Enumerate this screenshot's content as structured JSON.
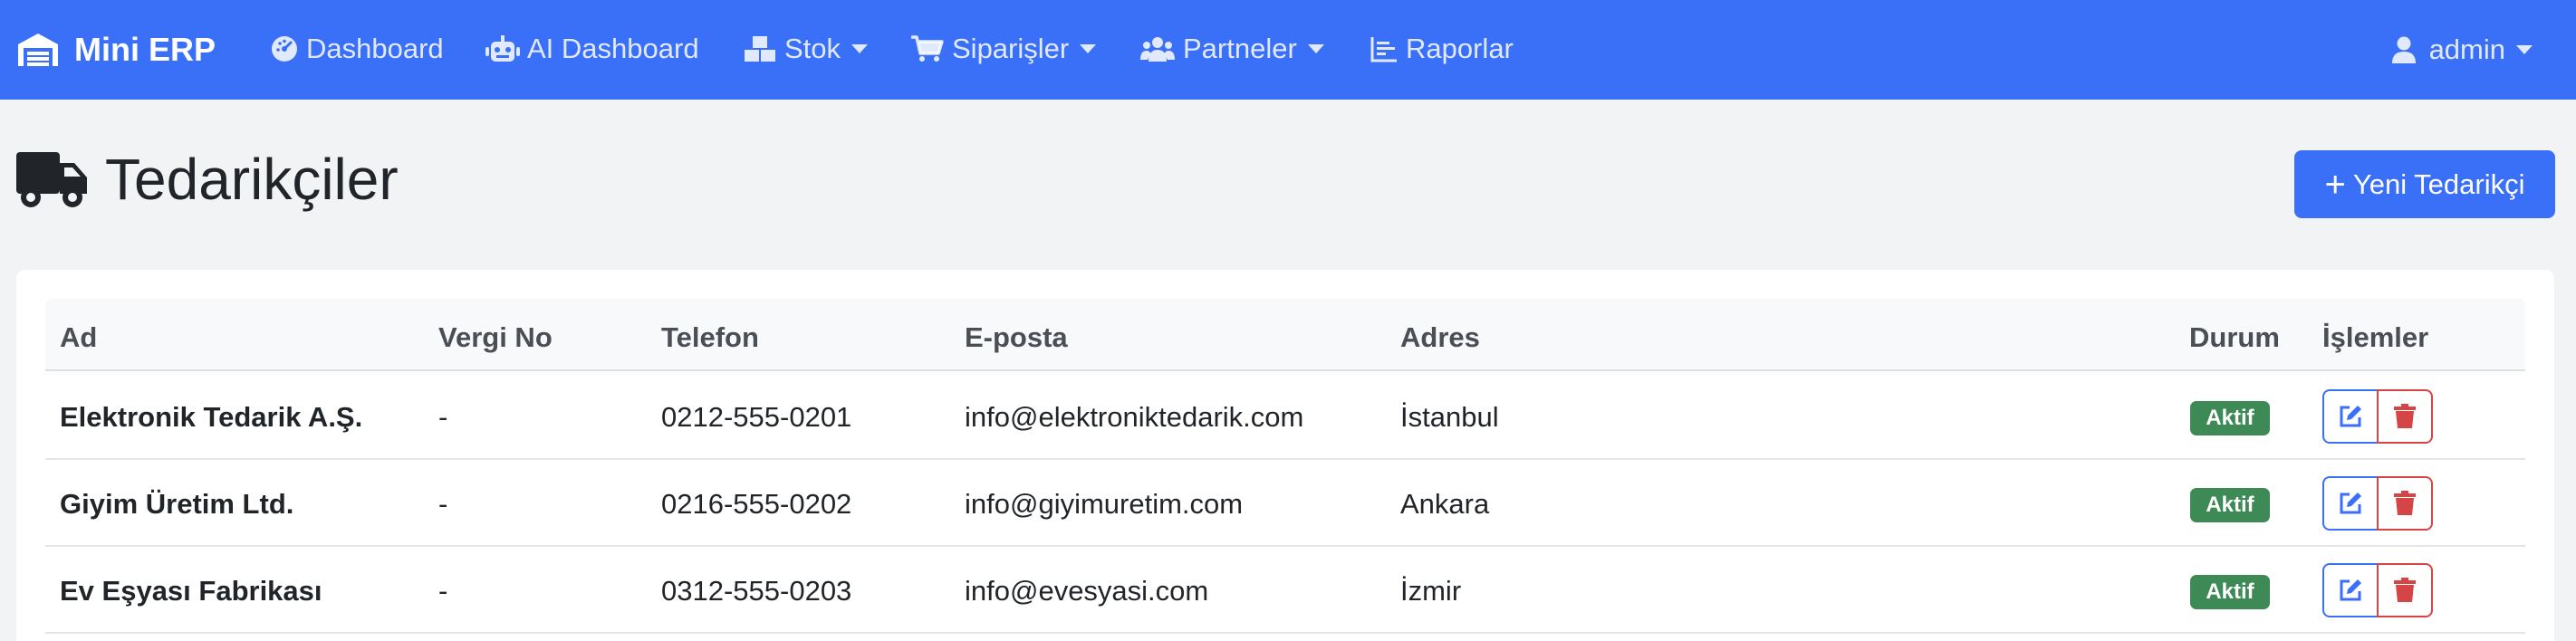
{
  "navbar": {
    "brand": "Mini ERP",
    "items": [
      {
        "label": "Dashboard",
        "icon": "dashboard-gauge-icon",
        "dropdown": false
      },
      {
        "label": "AI Dashboard",
        "icon": "robot-icon",
        "dropdown": false
      },
      {
        "label": "Stok",
        "icon": "boxes-icon",
        "dropdown": true
      },
      {
        "label": "Siparişler",
        "icon": "cart-icon",
        "dropdown": true
      },
      {
        "label": "Partneler",
        "icon": "users-icon",
        "dropdown": true
      },
      {
        "label": "Raporlar",
        "icon": "chart-icon",
        "dropdown": false
      }
    ],
    "user": "admin"
  },
  "page": {
    "title": "Tedarikçiler",
    "title_icon": "truck-icon",
    "new_button": "Yeni Tedarikçi"
  },
  "table": {
    "headers": [
      "Ad",
      "Vergi No",
      "Telefon",
      "E-posta",
      "Adres",
      "Durum",
      "İşlemler"
    ],
    "rows": [
      {
        "name": "Elektronik Tedarik A.Ş.",
        "tax_no": "-",
        "phone": "0212-555-0201",
        "email": "info@elektroniktedarik.com",
        "address": "İstanbul",
        "status": "Aktif"
      },
      {
        "name": "Giyim Üretim Ltd.",
        "tax_no": "-",
        "phone": "0216-555-0202",
        "email": "info@giyimuretim.com",
        "address": "Ankara",
        "status": "Aktif"
      },
      {
        "name": "Ev Eşyası Fabrikası",
        "tax_no": "-",
        "phone": "0312-555-0203",
        "email": "info@evesyasi.com",
        "address": "İzmir",
        "status": "Aktif"
      }
    ]
  },
  "colors": {
    "primary": "#3a6ff7",
    "success": "#3d8a56",
    "danger": "#d64545",
    "background": "#f2f3f5"
  }
}
